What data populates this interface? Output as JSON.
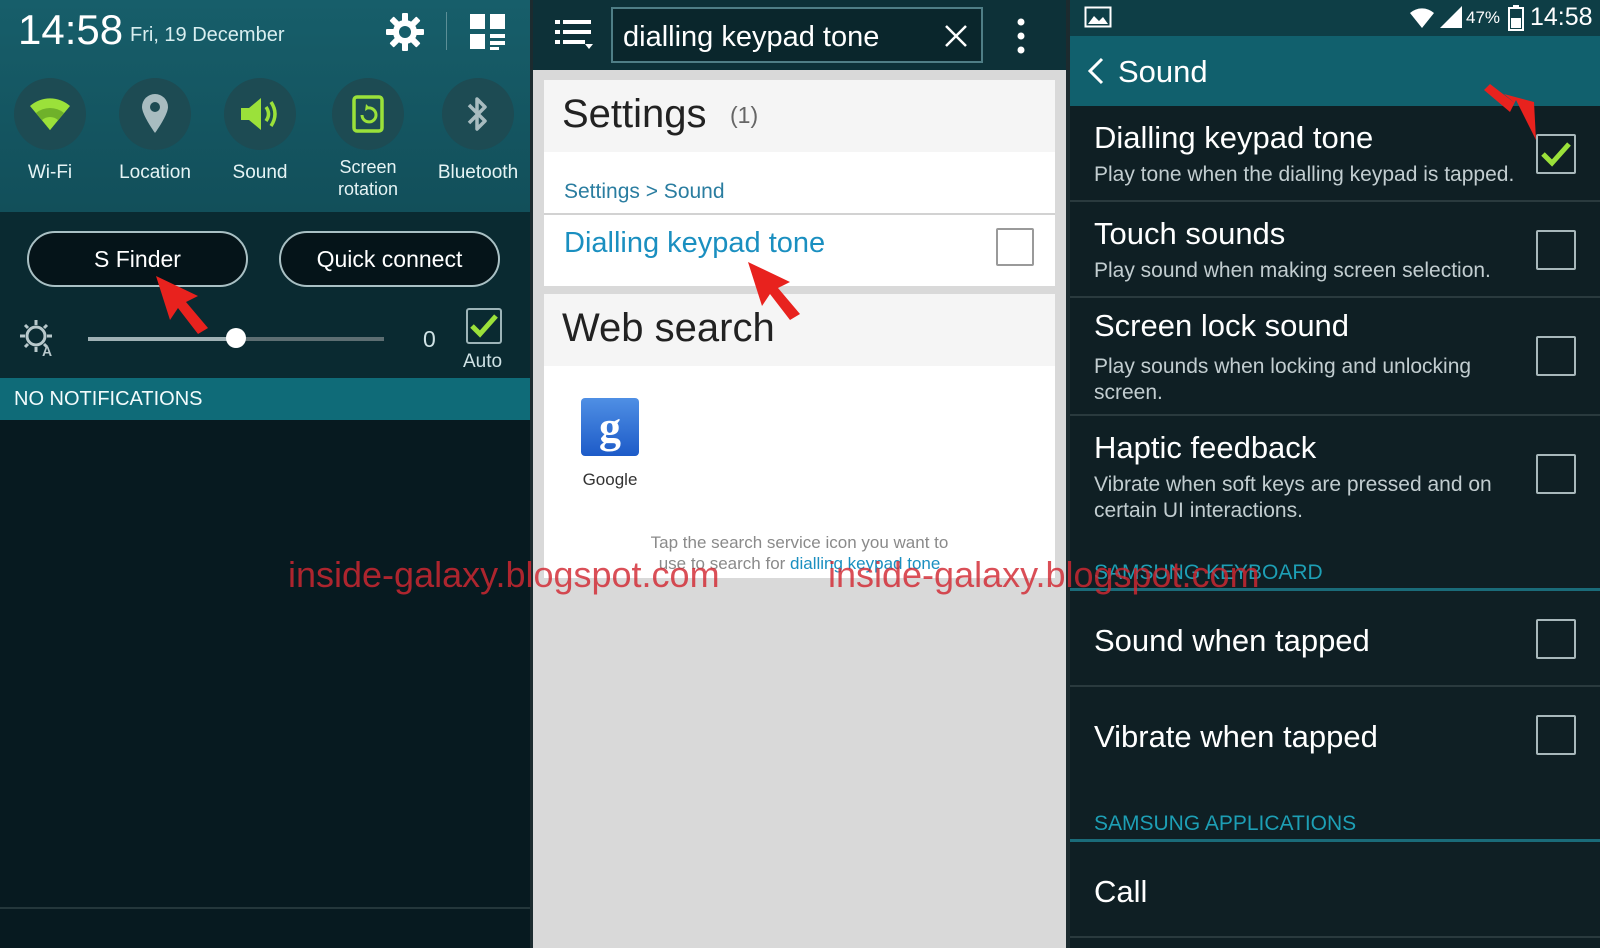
{
  "notification_panel": {
    "time": "14:58",
    "date": "Fri, 19 December",
    "quick_settings": [
      {
        "label": "Wi-Fi",
        "icon": "wifi-icon"
      },
      {
        "label": "Location",
        "icon": "location-pin-icon"
      },
      {
        "label": "Sound",
        "icon": "speaker-icon"
      },
      {
        "label": "Screen\nrotation",
        "icon": "screen-rotation-icon"
      },
      {
        "label": "Bluetooth",
        "icon": "bluetooth-icon"
      }
    ],
    "s_finder_label": "S Finder",
    "quick_connect_label": "Quick connect",
    "brightness_value": "0",
    "brightness_level": 0.5,
    "auto_label": "Auto",
    "auto_checked": true,
    "no_notifications": "NO NOTIFICATIONS",
    "accent": "#9be13a"
  },
  "search_screen": {
    "query": "dialling keypad tone",
    "settings_header": "Settings",
    "settings_count": "(1)",
    "breadcrumb": "Settings > Sound",
    "result_label": "Dialling keypad tone",
    "result_checked": false,
    "web_search_header": "Web search",
    "google_label": "Google",
    "hint_prefix": "Tap the search service icon you want to",
    "hint_middle": "use to search for ",
    "hint_link": "dialling keypad tone"
  },
  "sound_screen": {
    "battery": "47%",
    "time": "14:58",
    "title": "Sound",
    "items": [
      {
        "title": "Dialling keypad tone",
        "sub": "Play tone when the dialling keypad is tapped.",
        "checked": true
      },
      {
        "title": "Touch sounds",
        "sub": "Play sound when making screen selection.",
        "checked": false
      },
      {
        "title": "Screen lock sound",
        "sub": "Play sounds when locking and unlocking screen.",
        "checked": false
      },
      {
        "title": "Haptic feedback",
        "sub": "Vibrate when soft keys are pressed and on certain UI interactions.",
        "checked": false
      }
    ],
    "section_keyboard": "SAMSUNG KEYBOARD",
    "keyboard_items": [
      {
        "title": "Sound when tapped",
        "checked": false
      },
      {
        "title": "Vibrate when tapped",
        "checked": false
      }
    ],
    "section_apps": "SAMSUNG APPLICATIONS",
    "call_label": "Call"
  },
  "watermark": "inside-galaxy.blogspot.com"
}
